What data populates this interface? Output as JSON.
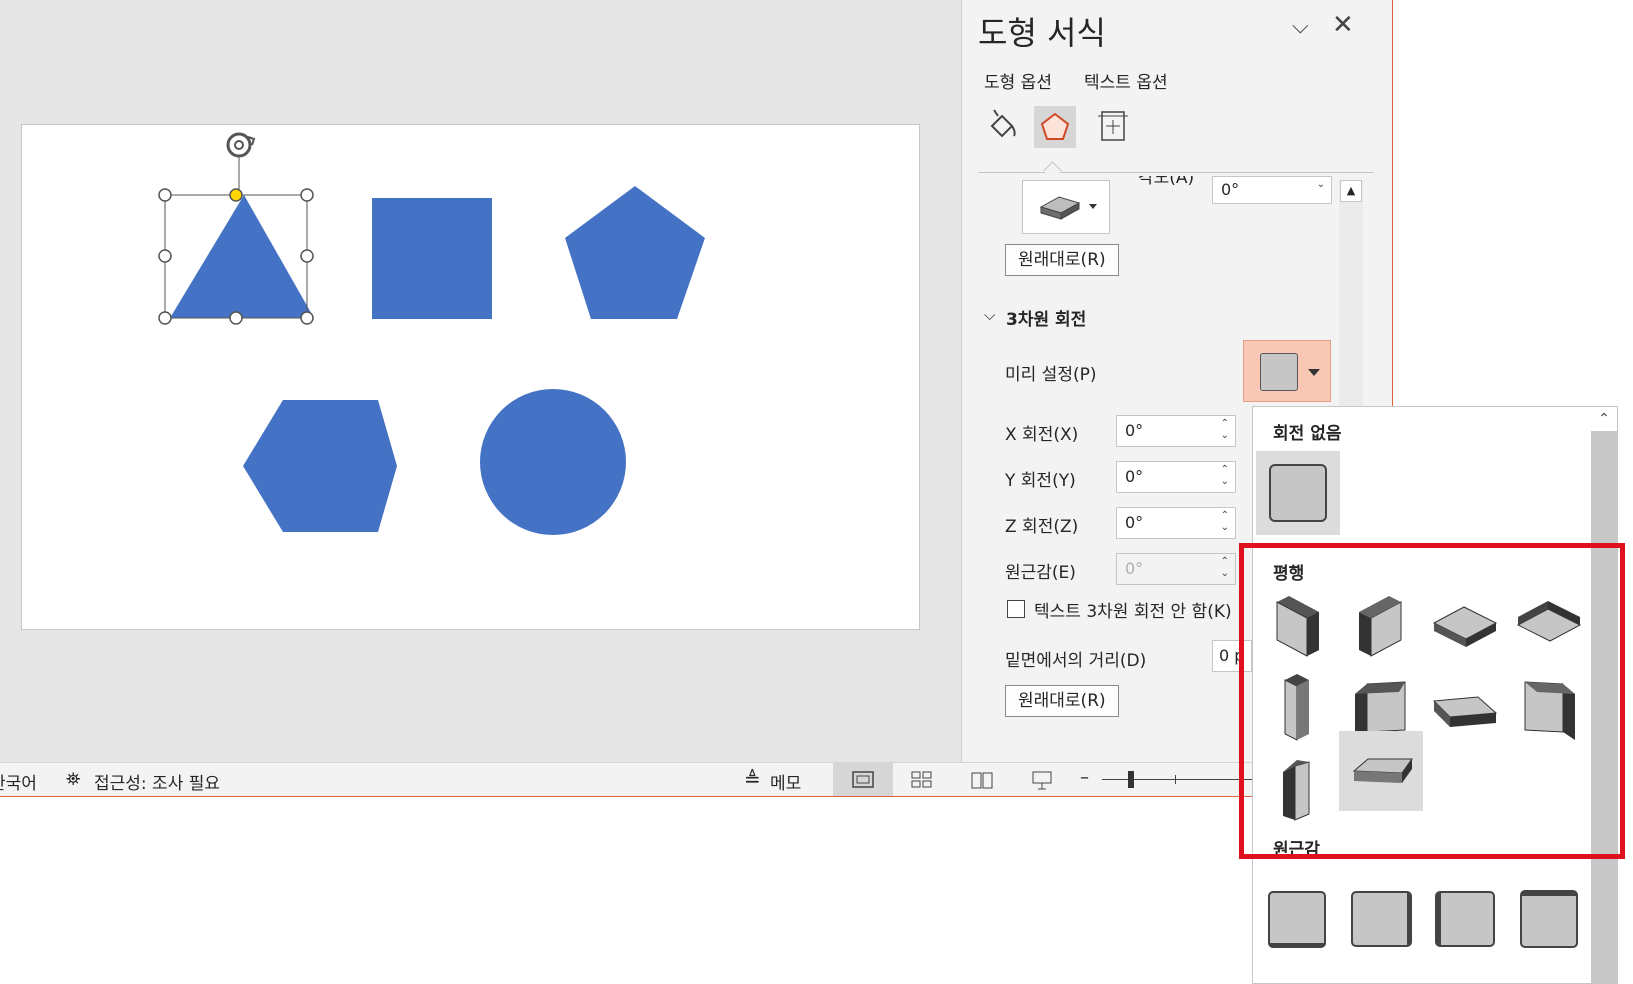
{
  "panel": {
    "title": "도형 서식",
    "tabs": [
      "도형 옵션",
      "텍스트 옵션"
    ],
    "angle_label_partial": "각도(A)",
    "angle_value": "0°",
    "reset_label": "원래대로(R)",
    "section_3d_rotation": "3차원 회전",
    "preset_label": "미리 설정(P)",
    "x_rotation_label": "X 회전(X)",
    "y_rotation_label": "Y 회전(Y)",
    "z_rotation_label": "Z 회전(Z)",
    "perspective_label": "원근감(E)",
    "x_rotation_value": "0°",
    "y_rotation_value": "0°",
    "z_rotation_value": "0°",
    "perspective_value": "0°",
    "keep_text_flat_label": "텍스트 3차원 회전 안 함(K)",
    "distance_label": "밑면에서의 거리(D)",
    "distance_value": "0 p",
    "reset_label_2": "원래대로(R)"
  },
  "gallery": {
    "group_no_rotation": "회전 없음",
    "group_parallel": "평행",
    "group_perspective": "원근감"
  },
  "status": {
    "language": "한국어",
    "accessibility": "접근성: 조사 필요",
    "notes": "메모"
  },
  "colors": {
    "shape_fill": "#4472c4",
    "highlight": "#e0111f",
    "window_border": "#e0603a",
    "preset_button": "#f8c8b4"
  }
}
